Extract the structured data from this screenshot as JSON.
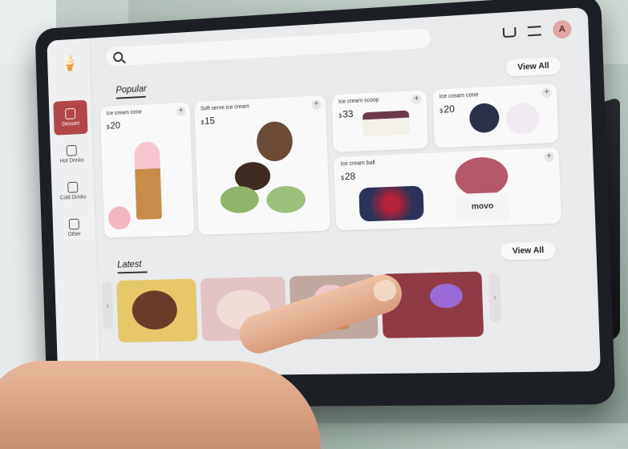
{
  "header": {
    "avatar_initial": "A"
  },
  "sidebar": {
    "items": [
      {
        "label": "Dessert"
      },
      {
        "label": "Hot Drinks"
      },
      {
        "label": "Cold Drinks"
      },
      {
        "label": "Other"
      }
    ]
  },
  "popular": {
    "title": "Popular",
    "view_all": "View All",
    "cards": [
      {
        "name": "Ice cream cone",
        "currency": "$",
        "price": "20"
      },
      {
        "name": "Soft serve ice cream",
        "currency": "$",
        "price": "15"
      },
      {
        "name": "Ice cream scoop",
        "currency": "$",
        "price": "33"
      },
      {
        "name": "Ice cream cone",
        "currency": "$",
        "price": "20"
      },
      {
        "name": "Ice cream ball",
        "currency": "$",
        "price": "28"
      }
    ]
  },
  "latest": {
    "title": "Latest",
    "view_all": "View All"
  },
  "brand_text": "movo",
  "colors": {
    "accent": "#b2474a",
    "screen_bg": "#e9eaec"
  }
}
